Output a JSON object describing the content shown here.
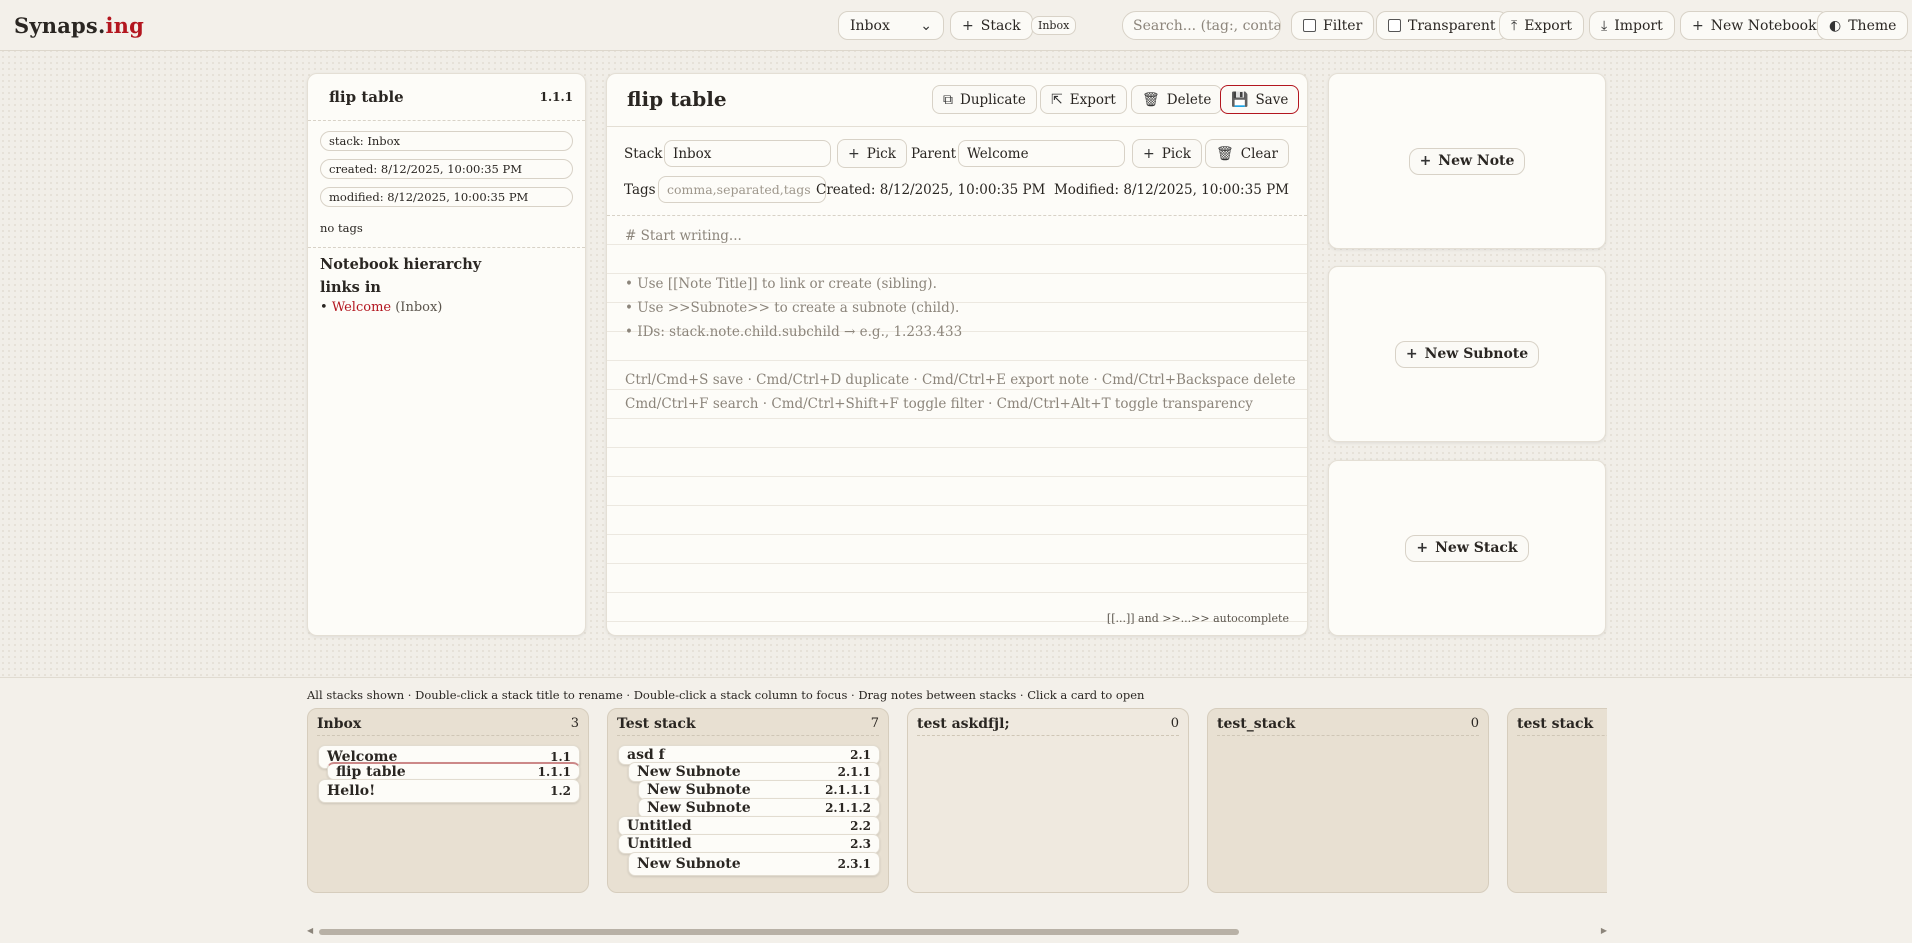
{
  "app": {
    "brand_main": "Synaps.",
    "brand_accent": "ing",
    "accent_color": "#b3161f"
  },
  "toolbar": {
    "stack_select": "Inbox",
    "stack_button": "Stack",
    "current_stack_chip": "Inbox",
    "search_placeholder": "Search... (tag:, contai",
    "filter_label": "Filter",
    "transparent_label": "Transparent",
    "export_label": "Export",
    "import_label": "Import",
    "new_notebook_label": "New Notebook",
    "theme_label": "Theme"
  },
  "meta": {
    "title": "flip table",
    "id": "1.1.1",
    "stack": "stack: Inbox",
    "created": "created: 8/12/2025, 10:00:35 PM",
    "modified": "modified: 8/12/2025, 10:00:35 PM",
    "tags": "no tags",
    "hierarchy_title": "Notebook hierarchy",
    "links_in_title": "links in",
    "link_bullet": "•",
    "link_name": "Welcome",
    "link_stack": "(Inbox)"
  },
  "editor": {
    "title": "flip table",
    "duplicate_label": "Duplicate",
    "export_label": "Export",
    "delete_label": "Delete",
    "save_label": "Save",
    "stack_label": "Stack",
    "stack_value": "Inbox",
    "pick_label": "Pick",
    "parent_label": "Parent",
    "parent_value": "Welcome",
    "parent_pick_label": "Pick",
    "clear_label": "Clear",
    "tags_label": "Tags",
    "tags_placeholder": "comma,separated,tags",
    "created": "Created: 8/12/2025, 10:00:35 PM",
    "modified": "Modified: 8/12/2025, 10:00:35 PM",
    "body_lines": [
      "# Start writing...",
      "",
      "• Use [[Note Title]] to link or create (sibling).",
      "• Use >>Subnote>> to create a subnote (child).",
      "• IDs: stack.note.child.subchild → e.g., 1.233.433",
      "",
      "Ctrl/Cmd+S save · Cmd/Ctrl+D duplicate · Cmd/Ctrl+E export note · Cmd/Ctrl+Backspace delete",
      "Cmd/Ctrl+F search · Cmd/Ctrl+Shift+F toggle filter · Cmd/Ctrl+Alt+T toggle transparency"
    ],
    "autocomplete_hint": "[[...]] and >>...>> autocomplete"
  },
  "actions": {
    "new_note": "New Note",
    "new_subnote": "New Subnote",
    "new_stack": "New Stack"
  },
  "bottom": {
    "hint": "All stacks shown · Double-click a stack title to rename · Double-click a stack column to focus · Drag notes between stacks · Click a card to open"
  },
  "stacks": [
    {
      "name": "Inbox",
      "count": "3",
      "cards": [
        {
          "title": "Welcome",
          "id": "1.1",
          "indent": 0
        },
        {
          "title": "flip table",
          "id": "1.1.1",
          "indent": 1
        },
        {
          "title": "Hello!",
          "id": "1.2",
          "indent": 0
        }
      ]
    },
    {
      "name": "Test stack",
      "count": "7",
      "cards": [
        {
          "title": "asd f",
          "id": "2.1",
          "indent": 0
        },
        {
          "title": "New Subnote",
          "id": "2.1.1",
          "indent": 1
        },
        {
          "title": "New Subnote",
          "id": "2.1.1.1",
          "indent": 2
        },
        {
          "title": "New Subnote",
          "id": "2.1.1.2",
          "indent": 2
        },
        {
          "title": "Untitled",
          "id": "2.2",
          "indent": 0
        },
        {
          "title": "Untitled",
          "id": "2.3",
          "indent": 0
        },
        {
          "title": "New Subnote",
          "id": "2.3.1",
          "indent": 1
        }
      ]
    },
    {
      "name": "test askdfjl;",
      "count": "0",
      "cards": []
    },
    {
      "name": "test_stack",
      "count": "0",
      "cards": []
    },
    {
      "name": "test stack",
      "count": "",
      "cards": []
    }
  ]
}
